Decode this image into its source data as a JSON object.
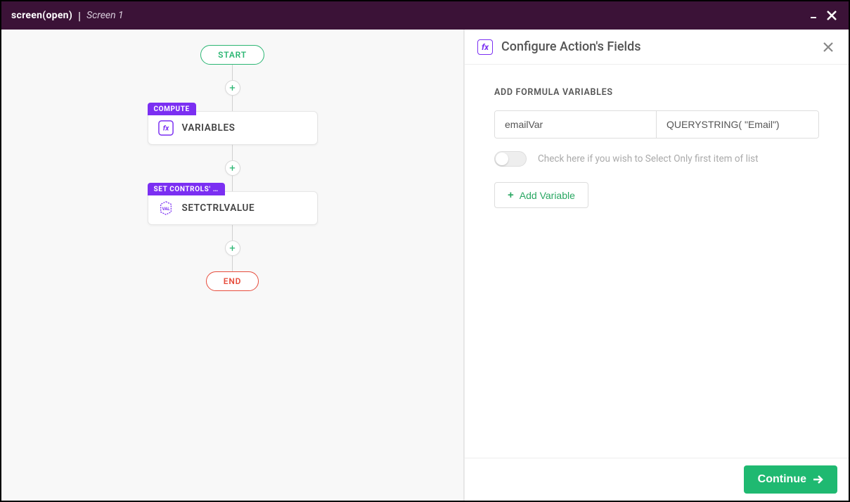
{
  "titlebar": {
    "strong": "screen(open)",
    "separator": "|",
    "sub": "Screen 1"
  },
  "flow": {
    "start": "START",
    "end": "END",
    "nodes": [
      {
        "badge": "COMPUTE",
        "label": "VARIABLES",
        "icon": "fx"
      },
      {
        "badge": "SET CONTROLS' VA...",
        "label": "SETCTRLVALUE",
        "icon": "val"
      }
    ]
  },
  "panel": {
    "title": "Configure Action's Fields",
    "section_label": "ADD FORMULA VARIABLES",
    "var_name": "emailVar",
    "var_formula": "QUERYSTRING( \"Email\")",
    "toggle_label": "Check here if you wish to Select Only first item of list",
    "add_variable": "Add Variable",
    "continue": "Continue"
  }
}
